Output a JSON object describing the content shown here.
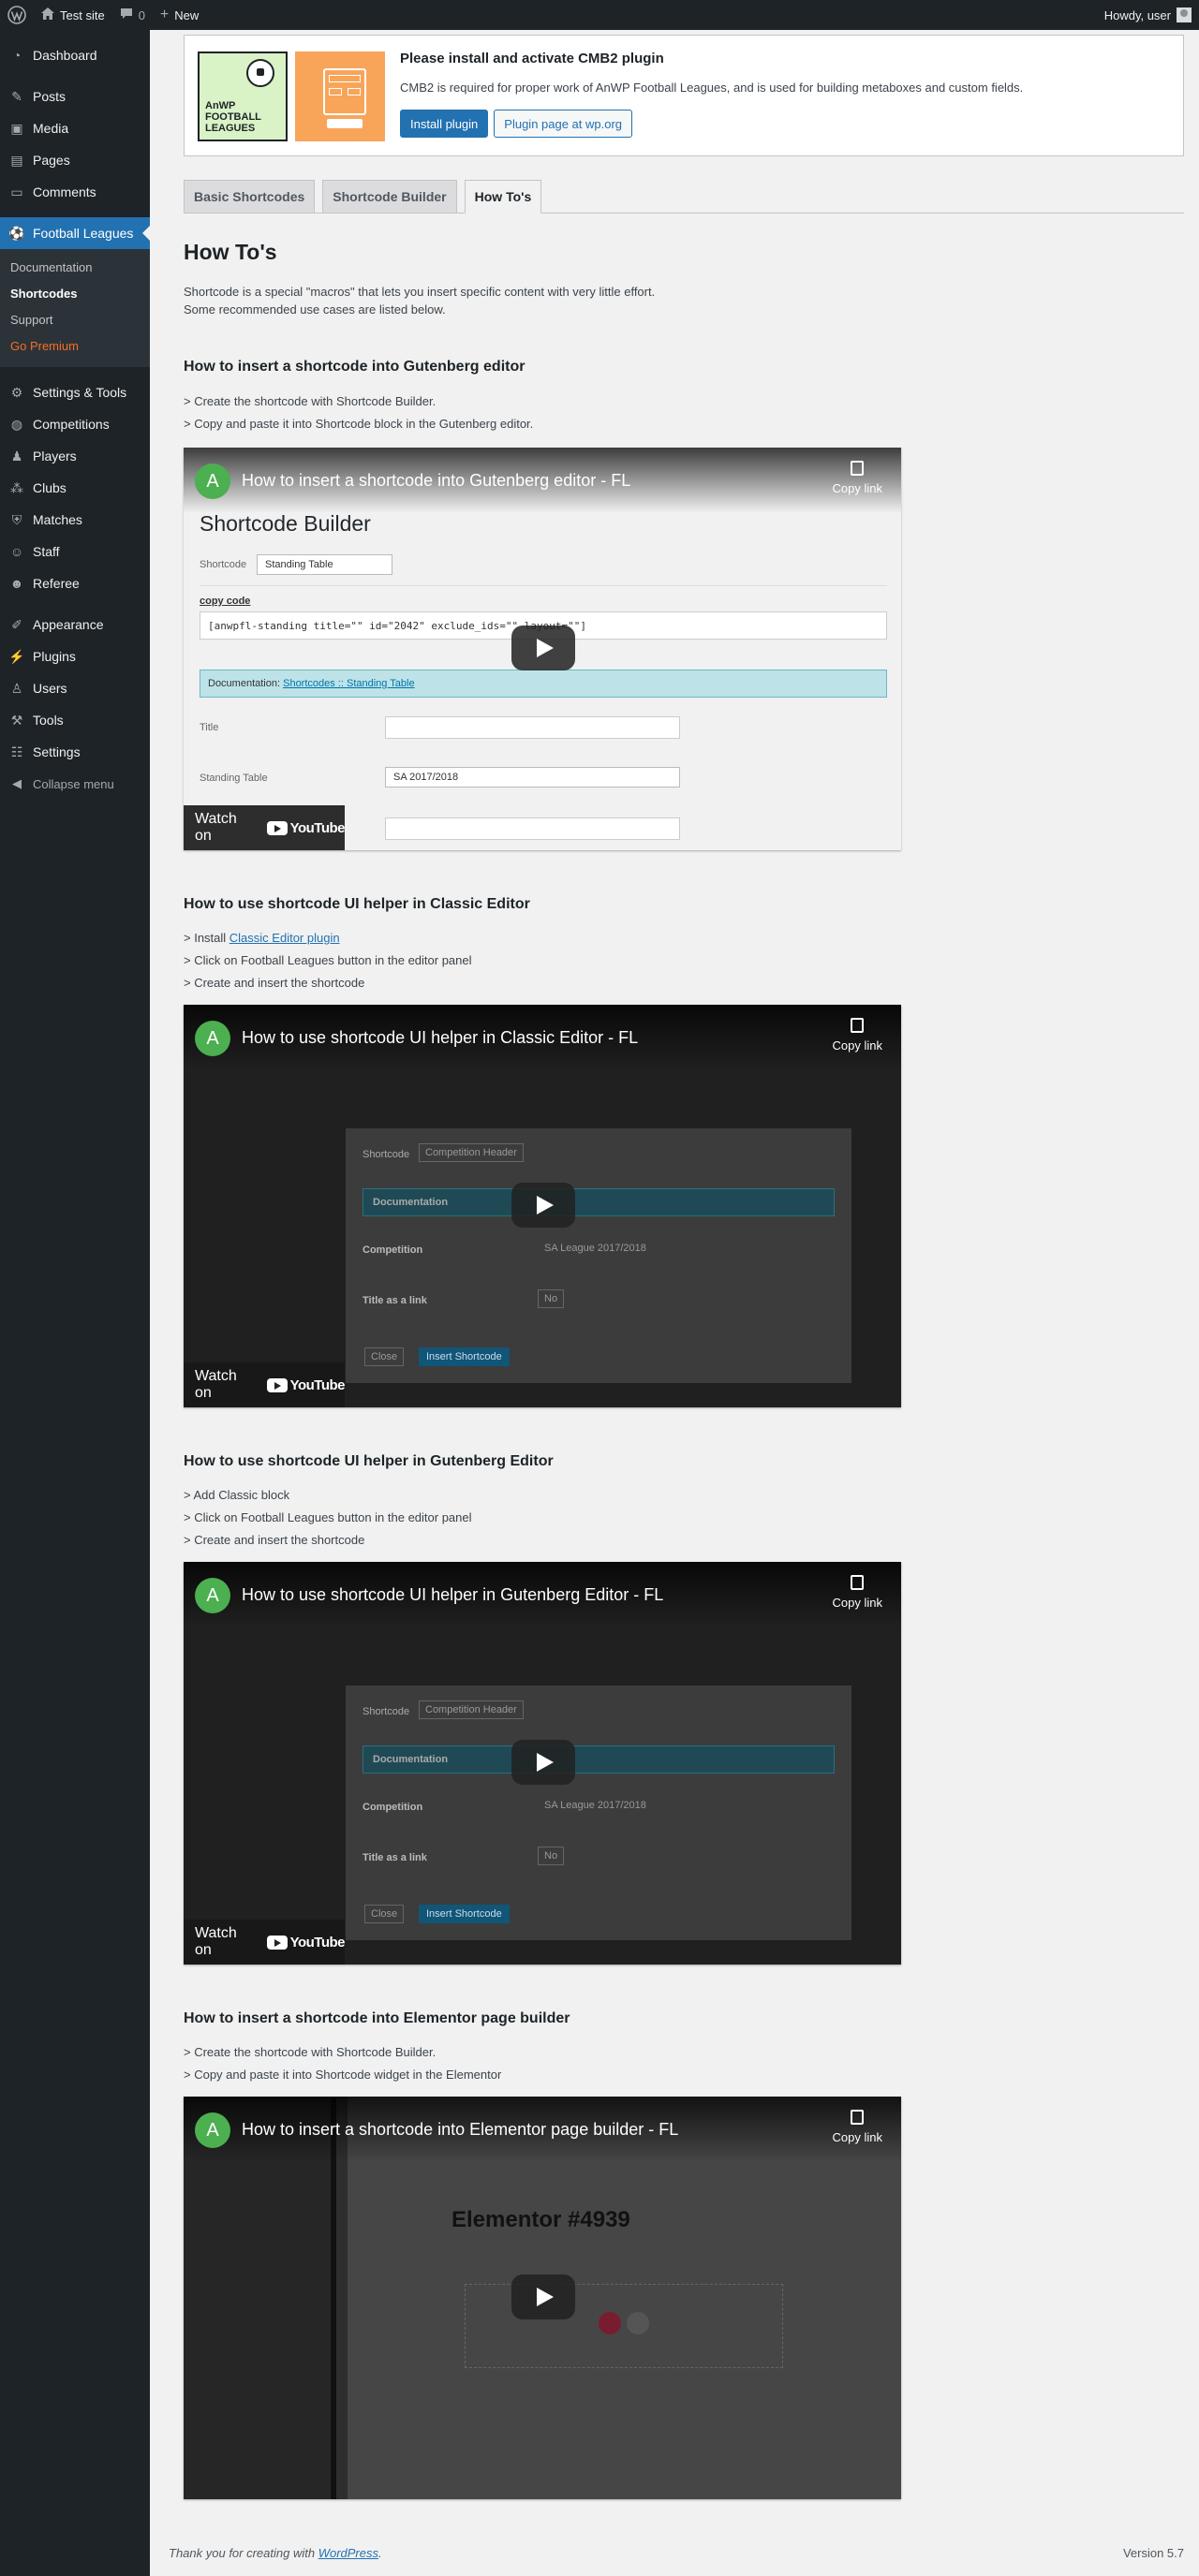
{
  "adminbar": {
    "site_name": "Test site",
    "comments_count": "0",
    "new_label": "New",
    "howdy": "Howdy, user"
  },
  "sidebar": {
    "items_top": [
      {
        "label": "Dashboard",
        "icon": "dashboard-icon"
      },
      {
        "label": "Posts",
        "icon": "pin-icon"
      },
      {
        "label": "Media",
        "icon": "media-icon"
      },
      {
        "label": "Pages",
        "icon": "pages-icon"
      },
      {
        "label": "Comments",
        "icon": "comment-icon"
      }
    ],
    "active": {
      "label": "Football Leagues",
      "icon": "soccer-ball-icon"
    },
    "submenu": [
      "Documentation",
      "Shortcodes",
      "Support",
      "Go Premium"
    ],
    "items_mid": [
      {
        "label": "Settings & Tools",
        "icon": "gear-icon"
      },
      {
        "label": "Competitions",
        "icon": "globe-icon"
      },
      {
        "label": "Players",
        "icon": "players-icon"
      },
      {
        "label": "Clubs",
        "icon": "groups-icon"
      },
      {
        "label": "Matches",
        "icon": "shield-icon"
      },
      {
        "label": "Staff",
        "icon": "staff-icon"
      },
      {
        "label": "Referee",
        "icon": "referee-icon"
      }
    ],
    "items_bottom": [
      {
        "label": "Appearance",
        "icon": "brush-icon"
      },
      {
        "label": "Plugins",
        "icon": "plugin-icon"
      },
      {
        "label": "Users",
        "icon": "user-icon"
      },
      {
        "label": "Tools",
        "icon": "wrench-icon"
      },
      {
        "label": "Settings",
        "icon": "settings-icon"
      }
    ],
    "collapse": "Collapse menu"
  },
  "notice": {
    "logo_text_line1": "AnWP",
    "logo_text_line2": "FOOTBALL",
    "logo_text_line3": "LEAGUES",
    "title": "Please install and activate CMB2 plugin",
    "text": "CMB2 is required for proper work of AnWP Football Leagues, and is used for building metaboxes and custom fields.",
    "install_btn": "Install plugin",
    "plugin_page_btn": "Plugin page at wp.org"
  },
  "tabs": [
    "Basic Shortcodes",
    "Shortcode Builder",
    "How To's"
  ],
  "page": {
    "title": "How To's",
    "intro_line1": "Shortcode is a special \"macros\" that lets you insert specific content with very little effort.",
    "intro_line2": "Some recommended use cases are listed below."
  },
  "sections": [
    {
      "heading": "How to insert a shortcode into Gutenberg editor",
      "steps": [
        "> Create the shortcode with Shortcode Builder.",
        "> Copy and paste it into Shortcode block in the Gutenberg editor."
      ],
      "video_title": "How to insert a shortcode into Gutenberg editor - FL"
    },
    {
      "heading": "How to use shortcode UI helper in Classic Editor",
      "steps": [
        "> Install ",
        "> Click on Football Leagues button in the editor panel",
        "> Create and insert the shortcode"
      ],
      "link": "Classic Editor plugin",
      "video_title": "How to use shortcode UI helper in Classic Editor - FL"
    },
    {
      "heading": "How to use shortcode UI helper in Gutenberg Editor",
      "steps": [
        "> Add Classic block",
        "> Click on Football Leagues button in the editor panel",
        "> Create and insert the shortcode"
      ],
      "video_title": "How to use shortcode UI helper in Gutenberg Editor - FL"
    },
    {
      "heading": "How to insert a shortcode into Elementor page builder",
      "steps": [
        "> Create the shortcode with Shortcode Builder.",
        "> Copy and paste it into Shortcode widget in the Elementor"
      ],
      "video_title": "How to insert a shortcode into Elementor page builder - FL"
    }
  ],
  "video": {
    "channel_initial": "A",
    "copy_link": "Copy link",
    "watch_on": "Watch on",
    "youtube": "YouTube"
  },
  "thumb1": {
    "title": "Shortcode Builder",
    "shortcode_label": "Shortcode",
    "shortcode_value": "Standing Table",
    "copy_code": "copy code",
    "code": "[anwpfl-standing title=\"\" id=\"2042\" exclude_ids=\"\" layout=\"\"]",
    "doc_label": "Documentation:",
    "doc_link": "Shortcodes :: Standing Table",
    "title_label": "Title",
    "standing_label": "Standing Table",
    "standing_value": "SA 2017/2018"
  },
  "thumb_modal": {
    "shortcode_label": "Shortcode",
    "shortcode_value": "Competition Header",
    "doc": "Documentation",
    "competition_label": "Competition",
    "competition_value": "SA League 2017/2018",
    "title_link_label": "Title as a link",
    "title_link_value": "No",
    "close": "Close",
    "insert": "Insert Shortcode"
  },
  "thumb4": {
    "title": "Elementor #4939"
  },
  "footer": {
    "thanks_prefix": "Thank you for creating with ",
    "thanks_link": "WordPress",
    "thanks_suffix": ".",
    "version": "Version 5.7"
  },
  "colors": {
    "accent": "#2271b1",
    "admin_dark": "#1d2327",
    "premium": "#f56e28"
  }
}
